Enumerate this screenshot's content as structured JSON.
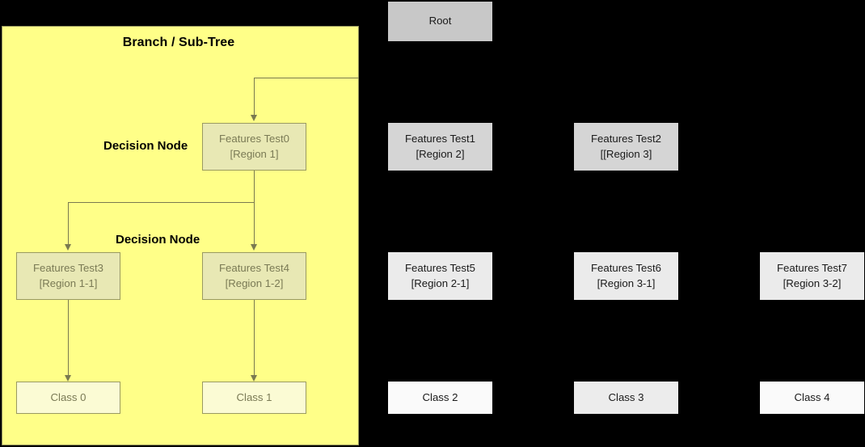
{
  "diagram": {
    "title_hidden": "",
    "background_color": "#000000",
    "highlight_panel": {
      "label": "Branch / Sub-Tree",
      "fill_color": "#ffff88",
      "border_color": "#8f8f5a"
    },
    "annotations": [
      {
        "label": "Decision Node"
      },
      {
        "label": "Decision Node"
      }
    ],
    "nodes": {
      "root": {
        "line1": "Root",
        "line2": ""
      },
      "test0": {
        "line1": "Features Test0",
        "line2": "[Region 1]"
      },
      "test1": {
        "line1": "Features Test1",
        "line2": "[Region 2]"
      },
      "test2": {
        "line1": "Features Test2",
        "line2": "[[Region 3]"
      },
      "test3": {
        "line1": "Features Test3",
        "line2": "[Region 1-1]"
      },
      "test4": {
        "line1": "Features Test4",
        "line2": "[Region 1-2]"
      },
      "test5": {
        "line1": "Features Test5",
        "line2": "[Region 2-1]"
      },
      "test6": {
        "line1": "Features Test6",
        "line2": "[Region 3-1]"
      },
      "test7": {
        "line1": "Features Test7",
        "line2": "[Region 3-2]"
      },
      "class0": {
        "line1": "Class 0",
        "line2": ""
      },
      "class1": {
        "line1": "Class 1",
        "line2": ""
      },
      "class2": {
        "line1": "Class 2",
        "line2": ""
      },
      "class3": {
        "line1": "Class 3",
        "line2": ""
      },
      "class4": {
        "line1": "Class 4",
        "line2": ""
      }
    },
    "colors": {
      "root_fill": "#c8c8c8",
      "internal_fill": "#d5d5d5",
      "internal2_fill": "#ebebeb",
      "leaf_white_fill": "#fafafa",
      "leaf_gray_fill": "#ececec",
      "highlight_decision_fill": "#e8e8b4",
      "highlight_leaf_fill": "#fbfbd4",
      "connector": "#7a7a50"
    }
  }
}
